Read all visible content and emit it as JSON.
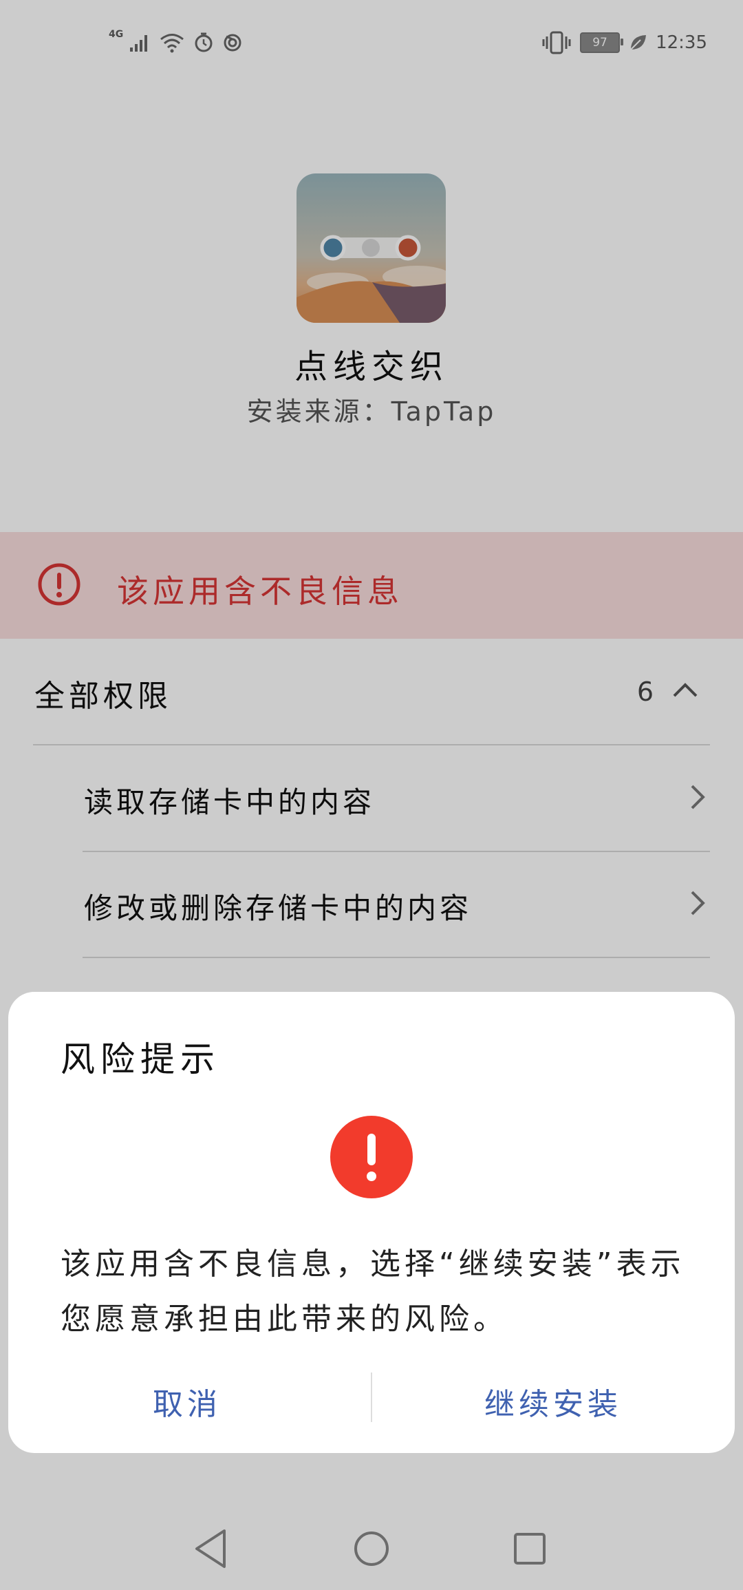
{
  "status_bar": {
    "network": "4G",
    "battery": "97",
    "time": "12:35"
  },
  "app": {
    "name": "点线交织",
    "install_source": "安装来源：TapTap"
  },
  "warning_banner": {
    "text": "该应用含不良信息",
    "color": "#d83535"
  },
  "permissions": {
    "title": "全部权限",
    "count": "6",
    "items": [
      {
        "label": "读取存储卡中的内容"
      },
      {
        "label": "修改或删除存储卡中的内容"
      }
    ]
  },
  "dialog": {
    "title": "风险提示",
    "message": "该应用含不良信息，选择“继续安装”表示您愿意承担由此带来的风险。",
    "cancel_label": "取消",
    "continue_label": "继续安装",
    "accent_color": "#3f61b0",
    "alert_color": "#f23b2c"
  },
  "icons": [
    "vibrate-icon",
    "wifi-icon",
    "signal-icon",
    "alarm-icon",
    "sync-icon",
    "leaf-icon",
    "alert-icon",
    "chevron-up-icon",
    "chevron-right-icon",
    "back-icon",
    "home-icon",
    "recents-icon"
  ]
}
